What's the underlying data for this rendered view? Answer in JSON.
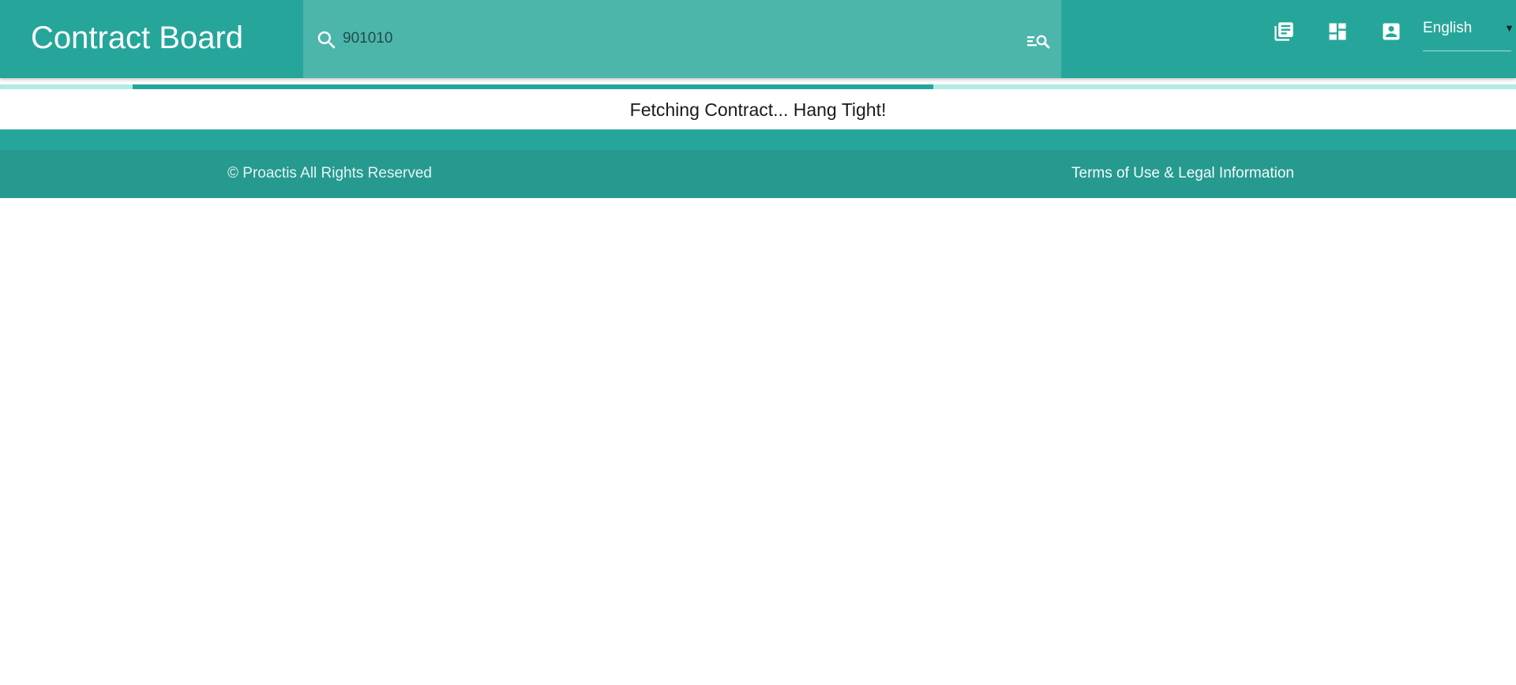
{
  "header": {
    "brand": "Contract Board",
    "search": {
      "value": "901010",
      "icon": "search-icon",
      "advanced_icon": "advanced-search-icon"
    },
    "actions": [
      {
        "icon": "library-books-icon"
      },
      {
        "icon": "dashboard-icon"
      },
      {
        "icon": "account-box-icon"
      }
    ],
    "language": {
      "selected": "English",
      "caret": "▼"
    }
  },
  "loading": {
    "progress": 0.43,
    "message": "Fetching Contract... Hang Tight!"
  },
  "footer": {
    "copyright": "© Proactis All Rights Reserved",
    "legal_link": "Terms of Use & Legal Information"
  },
  "colors": {
    "primary": "#26a69a",
    "search_background": "#4db6ac",
    "progress_track": "#b2ebe6",
    "footer": "#269a8f"
  }
}
